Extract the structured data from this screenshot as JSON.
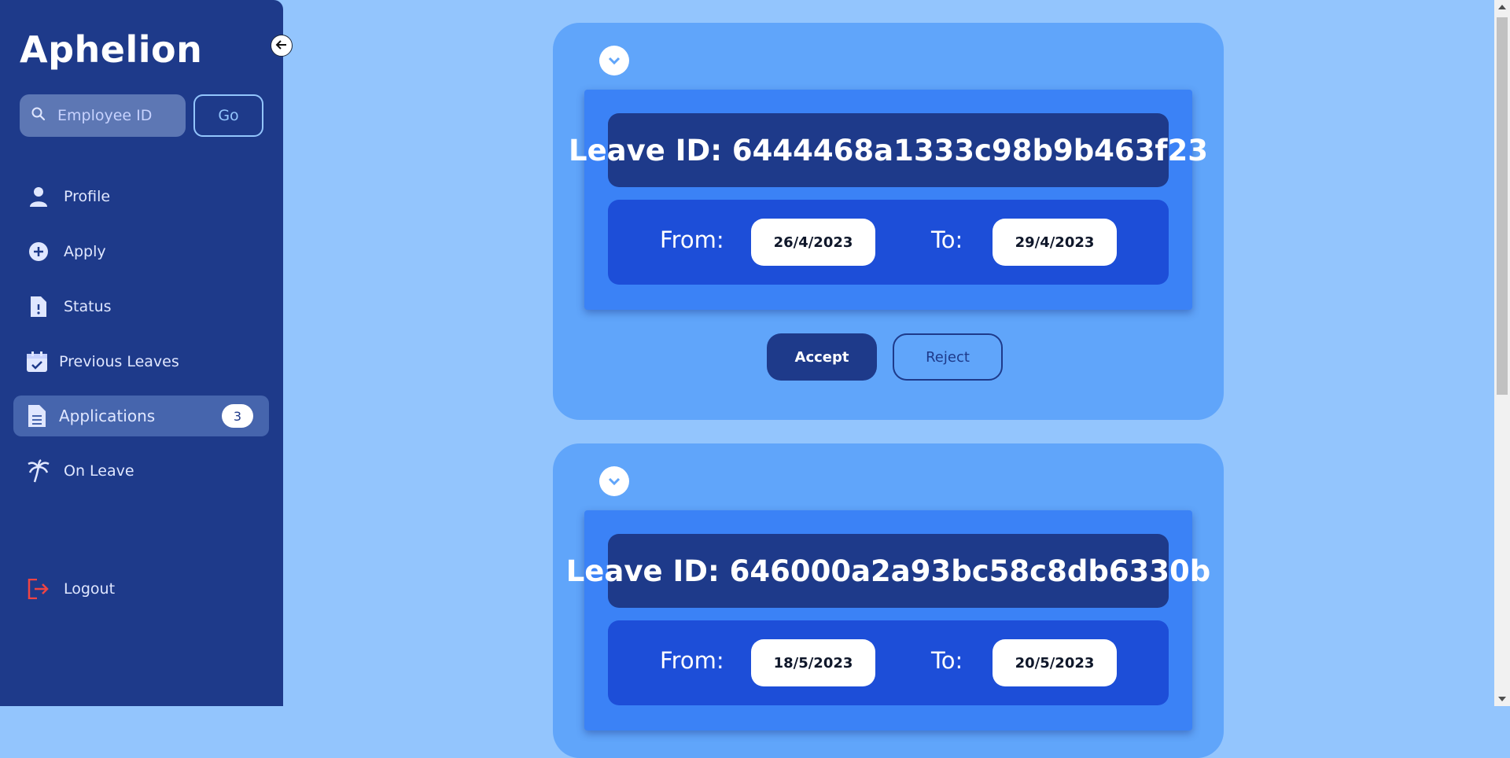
{
  "app": {
    "title": "Aphelion"
  },
  "search": {
    "placeholder": "Employee ID",
    "value": "",
    "go_label": "Go"
  },
  "sidebar": {
    "items": [
      {
        "label": "Profile",
        "icon": "user-icon"
      },
      {
        "label": "Apply",
        "icon": "plus-circle-icon"
      },
      {
        "label": "Status",
        "icon": "file-exclamation-icon"
      },
      {
        "label": "Previous Leaves",
        "icon": "calendar-check-icon"
      },
      {
        "label": "Applications",
        "icon": "document-icon",
        "active": true,
        "badge": "3"
      },
      {
        "label": "On Leave",
        "icon": "palm-tree-icon"
      }
    ],
    "logout_label": "Logout"
  },
  "applications": [
    {
      "leave_id": "Leave ID: 6444468a1333c98b9b463f23",
      "from_label": "From:",
      "from": "26/4/2023",
      "to_label": "To:",
      "to": "29/4/2023",
      "accept_label": "Accept",
      "reject_label": "Reject"
    },
    {
      "leave_id": "Leave ID: 646000a2a93bc58c8db6330b",
      "from_label": "From:",
      "from": "18/5/2023",
      "to_label": "To:",
      "to": "20/5/2023"
    }
  ],
  "colors": {
    "background": "#93c5fd",
    "sidebar": "#1e3a8a",
    "card": "#60a5fa",
    "panel": "#3b82f6",
    "leave_id_bg": "#1e3a8a",
    "dates_bg": "#1d4ed8",
    "logout_icon": "#ef4444"
  }
}
